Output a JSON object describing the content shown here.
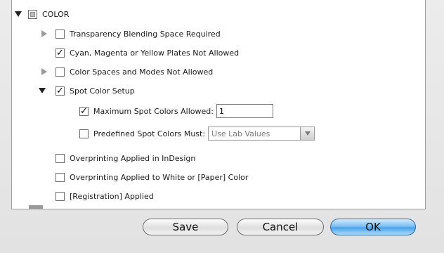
{
  "tree": {
    "color_section": {
      "label": "COLOR"
    },
    "items": [
      {
        "label": "Transparency Blending Space Required"
      },
      {
        "label": "Cyan, Magenta or Yellow Plates Not Allowed"
      },
      {
        "label": "Color Spaces and Modes Not Allowed"
      },
      {
        "label": "Spot Color Setup"
      },
      {
        "label": "Maximum Spot Colors Allowed:"
      },
      {
        "label": "Predefined Spot Colors Must:"
      },
      {
        "label": "Overprinting Applied in InDesign"
      },
      {
        "label": "Overprinting Applied to White or [Paper] Color"
      },
      {
        "label": "[Registration] Applied"
      }
    ]
  },
  "max_spot_value": "1",
  "predefined_select": {
    "value": "Use Lab Values"
  },
  "buttons": {
    "save": "Save",
    "cancel": "Cancel",
    "ok": "OK"
  },
  "colors": {
    "accent": "#4aa3ea",
    "scroll_thumb": "#3f83de"
  }
}
